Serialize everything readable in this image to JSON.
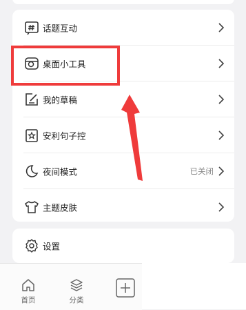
{
  "menu": {
    "items": [
      {
        "label": "话题互动",
        "icon": "hashtag-icon"
      },
      {
        "label": "桌面小工具",
        "icon": "widget-icon"
      },
      {
        "label": "我的草稿",
        "icon": "draft-icon"
      },
      {
        "label": "安利句子控",
        "icon": "star-badge-icon"
      },
      {
        "label": "夜间模式",
        "icon": "moon-icon",
        "value": "已关闭"
      },
      {
        "label": "主题皮肤",
        "icon": "tshirt-icon"
      }
    ]
  },
  "settings": {
    "label": "设置",
    "icon": "gear-icon"
  },
  "tabbar": {
    "items": [
      {
        "label": "首页",
        "icon": "home-icon"
      },
      {
        "label": "分类",
        "icon": "layers-icon"
      },
      {
        "label": "",
        "icon": "plus-icon"
      }
    ]
  },
  "annotation": {
    "highlight_color": "#ef3b3b"
  }
}
